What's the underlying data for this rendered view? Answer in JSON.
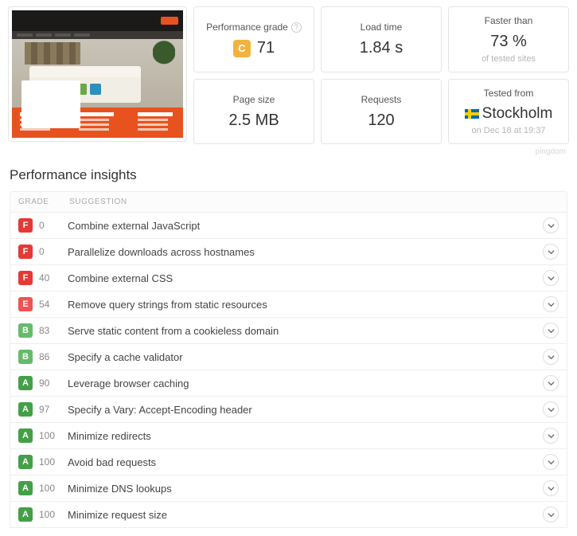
{
  "metrics": {
    "performance_grade": {
      "label": "Performance grade",
      "grade": "C",
      "score": "71"
    },
    "load_time": {
      "label": "Load time",
      "value": "1.84 s"
    },
    "faster_than": {
      "label": "Faster than",
      "value": "73 %",
      "sub": "of tested sites"
    },
    "page_size": {
      "label": "Page size",
      "value": "2.5 MB"
    },
    "requests": {
      "label": "Requests",
      "value": "120"
    },
    "tested_from": {
      "label": "Tested from",
      "city": "Stockholm",
      "sub": "on Dec 18 at 19:37"
    }
  },
  "brand": "pingdom",
  "insights_title": "Performance insights",
  "headers": {
    "grade": "GRADE",
    "suggestion": "SUGGESTION"
  },
  "insights": [
    {
      "grade": "F",
      "score": "0",
      "text": "Combine external JavaScript"
    },
    {
      "grade": "F",
      "score": "0",
      "text": "Parallelize downloads across hostnames"
    },
    {
      "grade": "F",
      "score": "40",
      "text": "Combine external CSS"
    },
    {
      "grade": "E",
      "score": "54",
      "text": "Remove query strings from static resources"
    },
    {
      "grade": "B",
      "score": "83",
      "text": "Serve static content from a cookieless domain"
    },
    {
      "grade": "B",
      "score": "86",
      "text": "Specify a cache validator"
    },
    {
      "grade": "A",
      "score": "90",
      "text": "Leverage browser caching"
    },
    {
      "grade": "A",
      "score": "97",
      "text": "Specify a Vary: Accept-Encoding header"
    },
    {
      "grade": "A",
      "score": "100",
      "text": "Minimize redirects"
    },
    {
      "grade": "A",
      "score": "100",
      "text": "Avoid bad requests"
    },
    {
      "grade": "A",
      "score": "100",
      "text": "Minimize DNS lookups"
    },
    {
      "grade": "A",
      "score": "100",
      "text": "Minimize request size"
    }
  ]
}
